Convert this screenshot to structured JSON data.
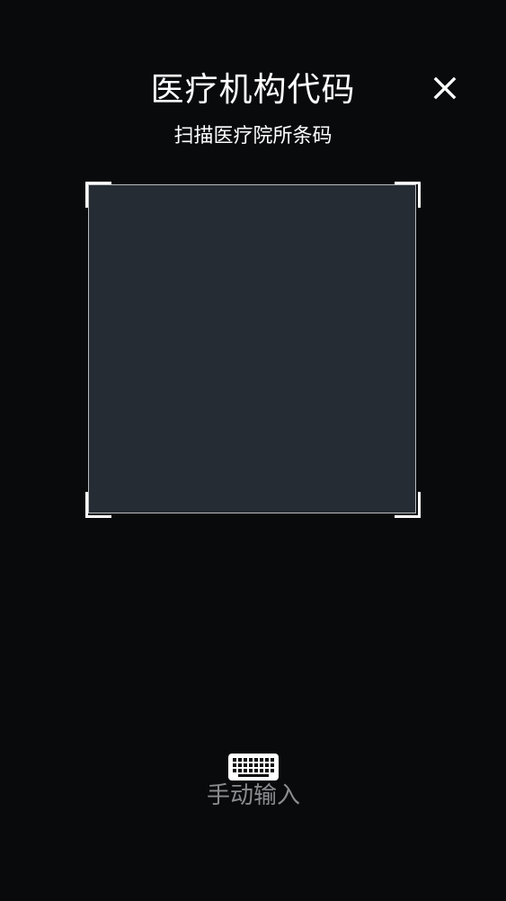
{
  "header": {
    "title": "医疗机构代码",
    "subtitle": "扫描医疗院所条码"
  },
  "icons": {
    "close": "close-icon",
    "keyboard": "keyboard-icon"
  },
  "manual_entry": {
    "label": "手动输入"
  },
  "colors": {
    "background": "#090a0c",
    "scan_area": "#262c34",
    "text_primary": "#ffffff",
    "text_muted": "#8a8c90"
  }
}
